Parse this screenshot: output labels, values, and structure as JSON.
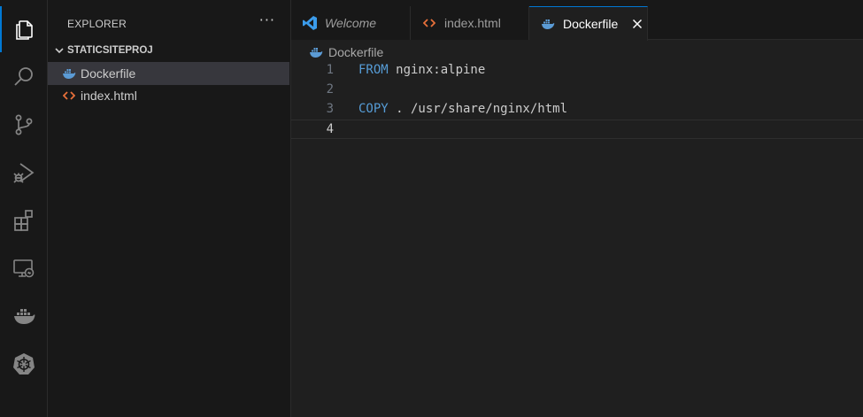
{
  "activity_bar": {
    "items": [
      {
        "icon": "files-icon",
        "active": true
      },
      {
        "icon": "search-icon"
      },
      {
        "icon": "source-control-icon"
      },
      {
        "icon": "run-debug-icon"
      },
      {
        "icon": "extensions-icon"
      },
      {
        "icon": "remote-explorer-icon"
      },
      {
        "icon": "docker-icon"
      },
      {
        "icon": "kubernetes-icon"
      }
    ]
  },
  "sidebar": {
    "title": "EXPLORER",
    "more": "···",
    "section": "STATICSITEPROJ",
    "files": [
      {
        "name": "Dockerfile",
        "icon": "docker-file-icon",
        "selected": true
      },
      {
        "name": "index.html",
        "icon": "html-file-icon"
      }
    ]
  },
  "tabs": [
    {
      "label": "Welcome",
      "icon": "vscode-icon"
    },
    {
      "label": "index.html",
      "icon": "html-file-icon"
    },
    {
      "label": "Dockerfile",
      "icon": "docker-file-icon",
      "active": true
    }
  ],
  "breadcrumb": {
    "file": "Dockerfile"
  },
  "editor": {
    "lines": [
      {
        "num": "1",
        "keyword": "FROM",
        "rest": " nginx:alpine"
      },
      {
        "num": "2",
        "keyword": "",
        "rest": ""
      },
      {
        "num": "3",
        "keyword": "COPY",
        "rest": " . /usr/share/nginx/html"
      },
      {
        "num": "4",
        "keyword": "",
        "rest": ""
      }
    ],
    "current_line": 4
  },
  "colors": {
    "accent": "#0078d4",
    "keyword": "#569cd6",
    "docker": "#5b9bd5",
    "html": "#e8703a"
  }
}
